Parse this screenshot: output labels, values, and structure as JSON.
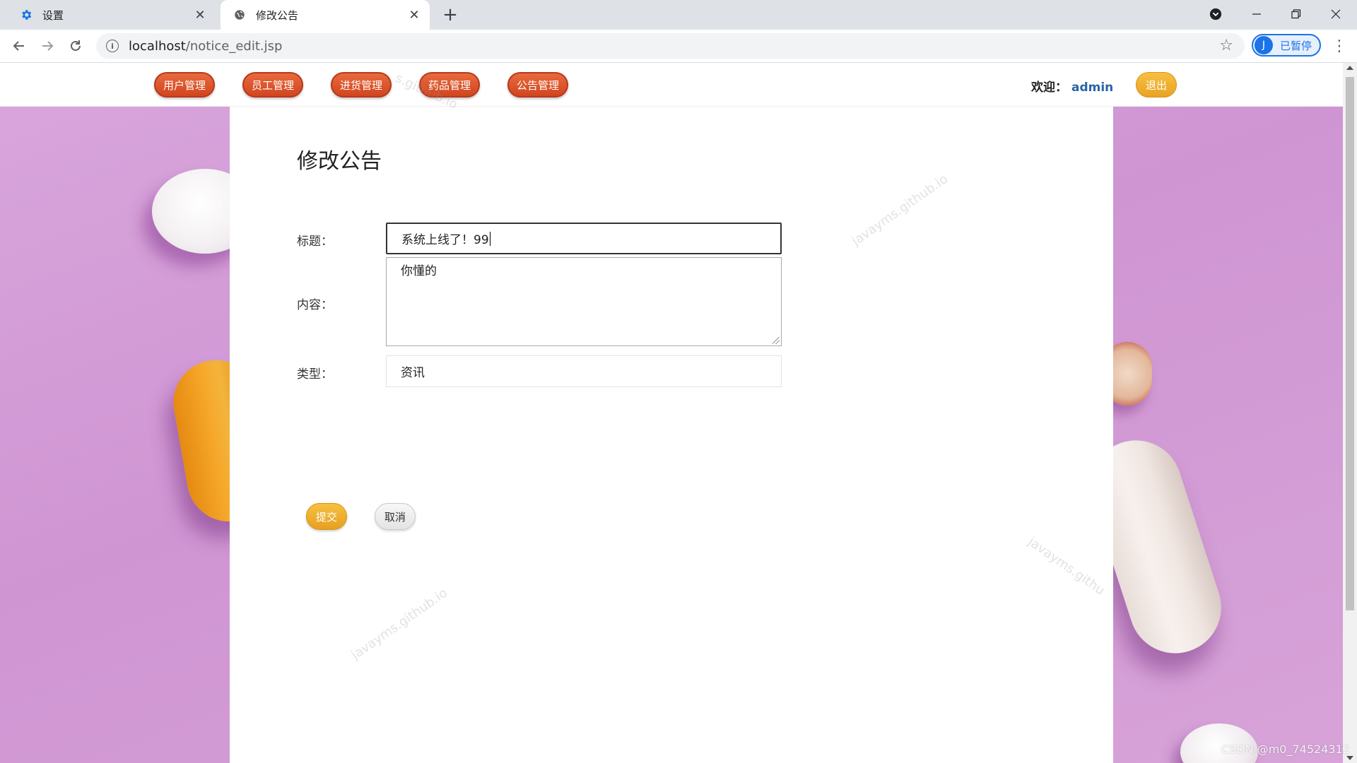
{
  "browser": {
    "tabs": [
      {
        "label": "设置",
        "icon": "gear-icon"
      },
      {
        "label": "修改公告",
        "icon": "globe-icon"
      }
    ],
    "url_host": "localhost",
    "url_path": "/notice_edit.jsp",
    "profile_initial": "J",
    "profile_label": "已暂停",
    "window_buttons": [
      "minimize-icon",
      "restore-icon",
      "close-icon"
    ]
  },
  "nav": {
    "items": [
      "用户管理",
      "员工管理",
      "进货管理",
      "药品管理",
      "公告管理"
    ],
    "welcome_label": "欢迎：",
    "username": "admin",
    "logout_label": "退出"
  },
  "form": {
    "page_title": "修改公告",
    "title_label": "标题：",
    "title_value": "系统上线了！99",
    "content_label": "内容：",
    "content_value": "你懂的",
    "type_label": "类型：",
    "type_value": "资讯",
    "submit_label": "提交",
    "cancel_label": "取消"
  },
  "watermarks": {
    "text": "javayms.github.io",
    "partial_left": "s.github.io",
    "partial_right": "javayms.githu",
    "csdn": "CSDN @m0_74524312"
  },
  "colors": {
    "nav_button": "#d9512a",
    "accent_yellow": "#f0b030",
    "link_blue": "#2a64a8",
    "background_purple": "#d39ed6"
  }
}
